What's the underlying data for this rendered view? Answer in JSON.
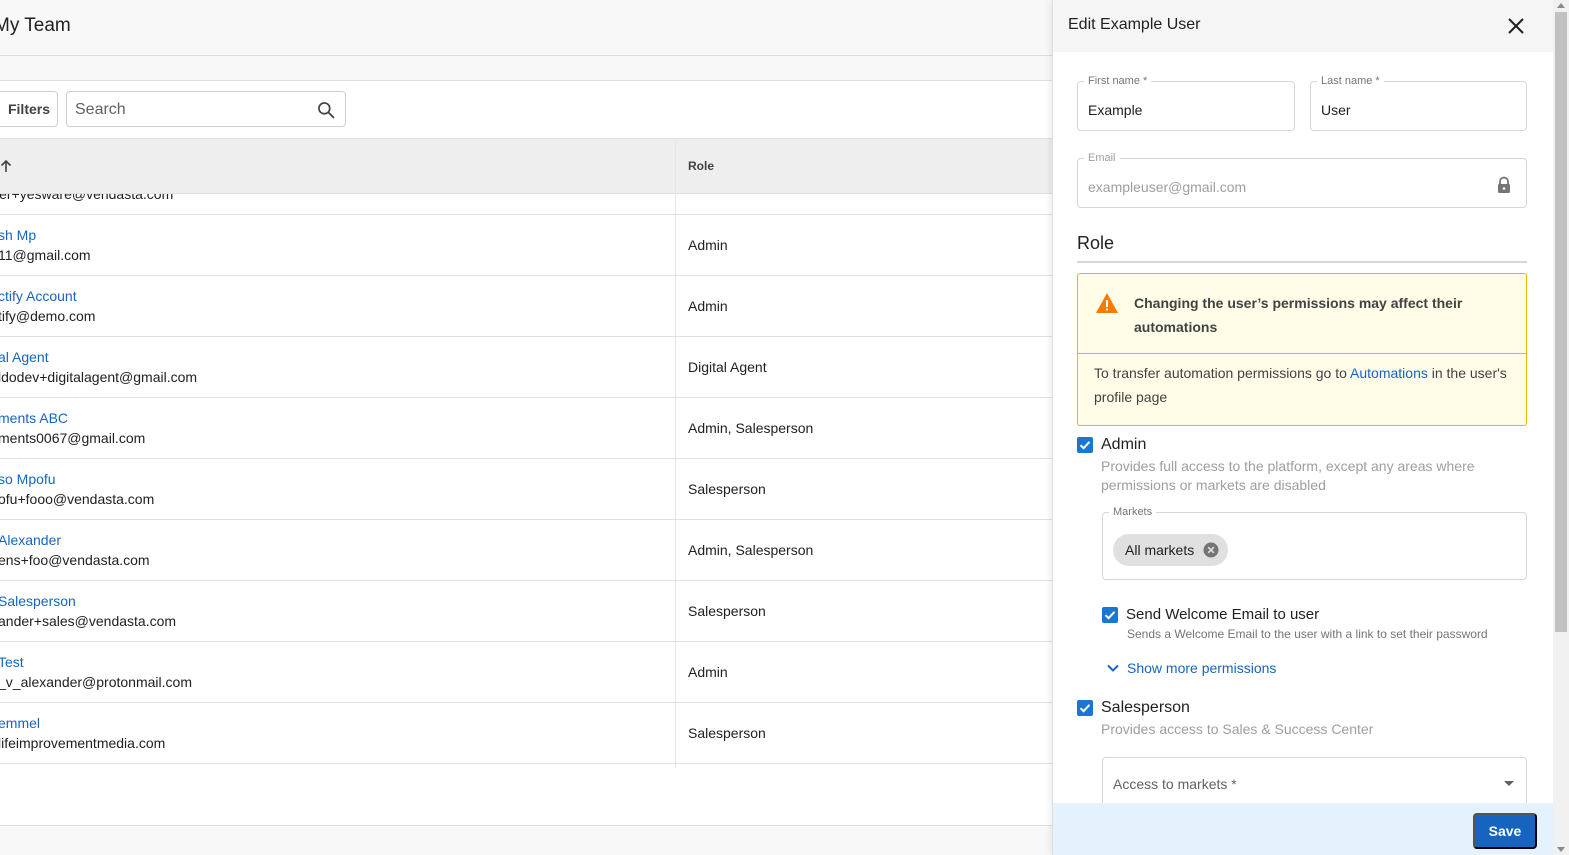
{
  "page": {
    "title": "My Team",
    "filters_label": "Filters",
    "search_placeholder": "Search",
    "column_role": "Role",
    "partial_row_email": "ler+yesware@vendasta.com",
    "rows": [
      {
        "name": "sh Mp",
        "email": "11@gmail.com",
        "role": "Admin"
      },
      {
        "name": "ctify Account",
        "email": "tify@demo.com",
        "role": "Admin"
      },
      {
        "name": "al Agent",
        "email": "ldodev+digitalagent@gmail.com",
        "role": "Digital Agent"
      },
      {
        "name": "ments ABC",
        "email": "ments0067@gmail.com",
        "role": "Admin, Salesperson"
      },
      {
        "name": "so Mpofu",
        "email": "ofu+fooo@vendasta.com",
        "role": "Salesperson"
      },
      {
        "name": " Alexander",
        "email": "ens+foo@vendasta.com",
        "role": "Admin, Salesperson"
      },
      {
        "name": " Salesperson",
        "email": "ander+sales@vendasta.com",
        "role": "Salesperson"
      },
      {
        "name": " Test",
        "email": "_v_alexander@protonmail.com",
        "role": "Admin"
      },
      {
        "name": "emmel",
        "email": "lifeimprovementmedia.com",
        "role": "Salesperson"
      }
    ]
  },
  "drawer": {
    "title": "Edit Example User",
    "first_name_label": "First name *",
    "first_name_value": "Example",
    "last_name_label": "Last name *",
    "last_name_value": "User",
    "email_label": "Email",
    "email_value": "exampleuser@gmail.com",
    "role_heading": "Role",
    "warning": {
      "title": "Changing the user’s permissions may affect their automations",
      "body_before": "To transfer automation permissions go to ",
      "link": "Automations",
      "body_after": " in the user's profile page"
    },
    "admin": {
      "label": "Admin",
      "checked": true,
      "description": "Provides full access to the platform, except any areas where permissions or markets are disabled",
      "markets_label": "Markets",
      "chip": "All markets"
    },
    "welcome_email": {
      "label": "Send Welcome Email to user",
      "checked": true,
      "description": "Sends a Welcome Email to the user with a link to set their password"
    },
    "show_more": "Show more permissions",
    "salesperson": {
      "label": "Salesperson",
      "checked": true,
      "description": "Provides access to Sales & Success Center"
    },
    "access_markets_placeholder": "Access to markets *",
    "save_label": "Save"
  },
  "colors": {
    "accent": "#1565c0",
    "checkbox": "#1976d2",
    "warning_border": "#f0b400",
    "warning_bg": "#fffde7",
    "warning_icon": "#f57c00",
    "footer_bg": "#e3f2fd"
  },
  "icons": [
    "search-icon",
    "sort-arrow-icon",
    "close-icon",
    "lock-icon",
    "warning-icon",
    "check-icon",
    "chip-remove-icon",
    "chevron-down-icon",
    "caret-down-icon"
  ]
}
